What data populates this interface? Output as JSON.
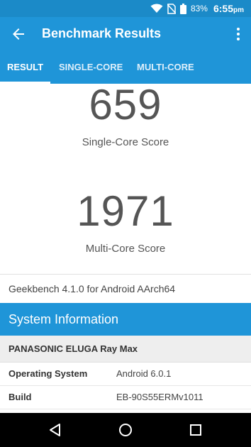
{
  "status_bar": {
    "battery_percent": "83%",
    "time": "6:55",
    "time_suffix": "pm"
  },
  "app_bar": {
    "title": "Benchmark Results"
  },
  "tabs": [
    {
      "label": "RESULT"
    },
    {
      "label": "SINGLE-CORE"
    },
    {
      "label": "MULTI-CORE"
    }
  ],
  "scores": {
    "single": {
      "value": "659",
      "label": "Single-Core Score"
    },
    "multi": {
      "value": "1971",
      "label": "Multi-Core Score"
    }
  },
  "version_text": "Geekbench 4.1.0 for Android AArch64",
  "system_info": {
    "header": "System Information",
    "device": "PANASONIC ELUGA Ray Max",
    "rows": [
      {
        "key": "Operating System",
        "value": "Android 6.0.1"
      },
      {
        "key": "Build",
        "value": "EB-90S55ERMv1011"
      }
    ]
  },
  "colors": {
    "primary": "#1f95d8",
    "status_bar": "#1b8ac8"
  }
}
